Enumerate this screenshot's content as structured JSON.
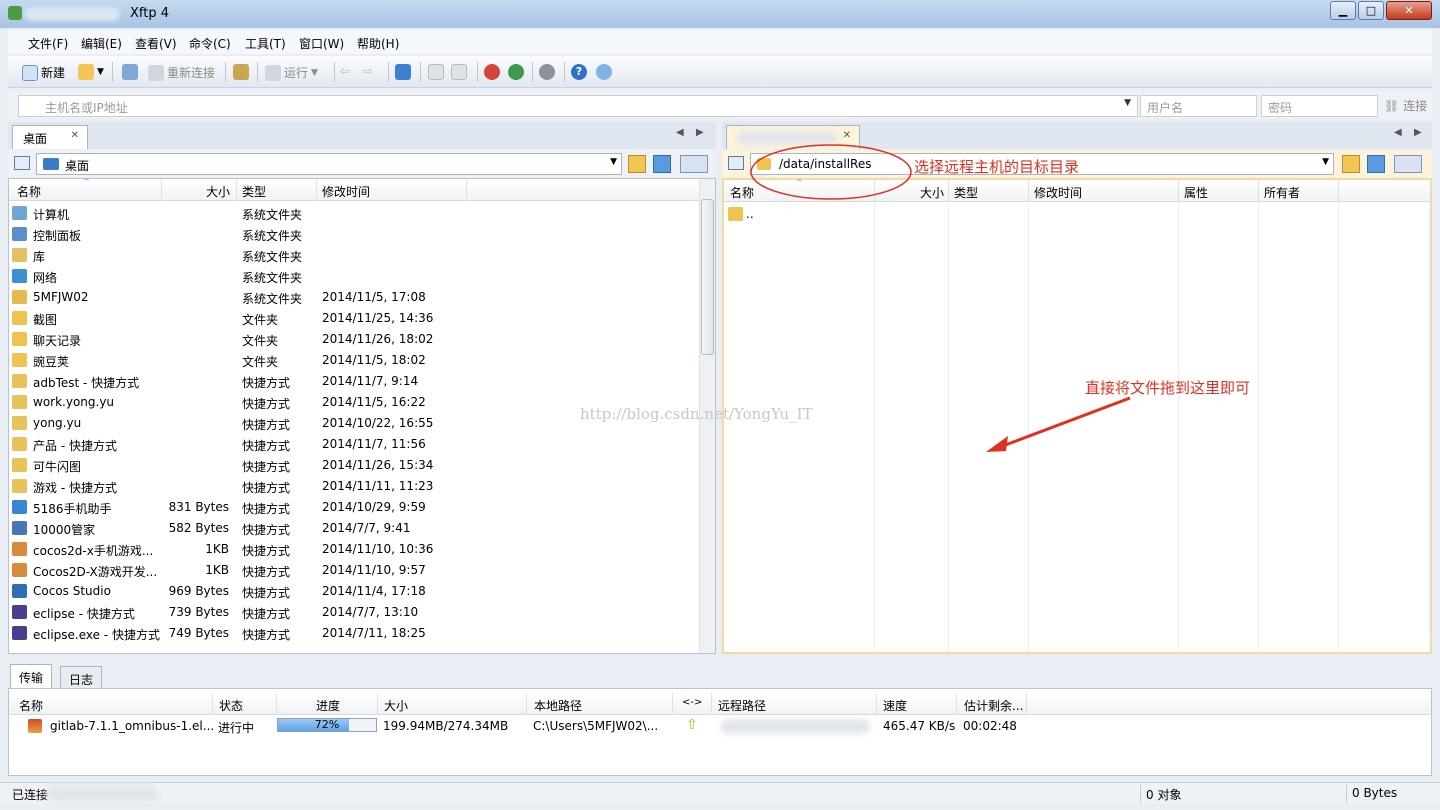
{
  "window": {
    "title": "Xftp 4"
  },
  "menu": [
    "文件(F)",
    "编辑(E)",
    "查看(V)",
    "命令(C)",
    "工具(T)",
    "窗口(W)",
    "帮助(H)"
  ],
  "toolbar": {
    "new_label": "新建",
    "reconnect_label": "重新连接",
    "run_label": "运行"
  },
  "address": {
    "host_placeholder": "主机名或IP地址",
    "user_placeholder": "用户名",
    "password_placeholder": "密码",
    "connect_label": "连接"
  },
  "left": {
    "tab_label": "桌面",
    "path": "桌面",
    "columns": [
      "名称",
      "大小",
      "类型",
      "修改时间"
    ],
    "rows": [
      {
        "name": "计算机",
        "size": "",
        "type": "系统文件夹",
        "modified": "",
        "icon": "computer-icon",
        "color": "#6fa6d6"
      },
      {
        "name": "控制面板",
        "size": "",
        "type": "系统文件夹",
        "modified": "",
        "icon": "control-panel-icon",
        "color": "#5a8fc8"
      },
      {
        "name": "库",
        "size": "",
        "type": "系统文件夹",
        "modified": "",
        "icon": "library-icon",
        "color": "#e2c162"
      },
      {
        "name": "网络",
        "size": "",
        "type": "系统文件夹",
        "modified": "",
        "icon": "network-icon",
        "color": "#3c8fd0"
      },
      {
        "name": "5MFJW02",
        "size": "",
        "type": "系统文件夹",
        "modified": "2014/11/5, 17:08",
        "icon": "user-folder-icon",
        "color": "#e6b94d"
      },
      {
        "name": "截图",
        "size": "",
        "type": "文件夹",
        "modified": "2014/11/25, 14:36",
        "icon": "folder-icon",
        "color": "#f0c24f"
      },
      {
        "name": "聊天记录",
        "size": "",
        "type": "文件夹",
        "modified": "2014/11/26, 18:02",
        "icon": "folder-icon",
        "color": "#f0c24f"
      },
      {
        "name": "豌豆荚",
        "size": "",
        "type": "文件夹",
        "modified": "2014/11/5, 18:02",
        "icon": "folder-icon",
        "color": "#f0c24f"
      },
      {
        "name": "adbTest - 快捷方式",
        "size": "",
        "type": "快捷方式",
        "modified": "2014/11/7, 9:14",
        "icon": "shortcut-icon",
        "color": "#e8c35a"
      },
      {
        "name": "work.yong.yu",
        "size": "",
        "type": "快捷方式",
        "modified": "2014/11/5, 16:22",
        "icon": "shortcut-icon",
        "color": "#e8c35a"
      },
      {
        "name": "yong.yu",
        "size": "",
        "type": "快捷方式",
        "modified": "2014/10/22, 16:55",
        "icon": "shortcut-icon",
        "color": "#e8c35a"
      },
      {
        "name": "产品 - 快捷方式",
        "size": "",
        "type": "快捷方式",
        "modified": "2014/11/7, 11:56",
        "icon": "shortcut-icon",
        "color": "#e8c35a"
      },
      {
        "name": "可牛闪图",
        "size": "",
        "type": "快捷方式",
        "modified": "2014/11/26, 15:34",
        "icon": "shortcut-icon",
        "color": "#e8c35a"
      },
      {
        "name": "游戏 - 快捷方式",
        "size": "",
        "type": "快捷方式",
        "modified": "2014/11/11, 11:23",
        "icon": "shortcut-icon",
        "color": "#e8c35a"
      },
      {
        "name": "5186手机助手",
        "size": "831 Bytes",
        "type": "快捷方式",
        "modified": "2014/10/29, 9:59",
        "icon": "app-shortcut-icon",
        "color": "#3a86d4"
      },
      {
        "name": "10000管家",
        "size": "582 Bytes",
        "type": "快捷方式",
        "modified": "2014/7/7, 9:41",
        "icon": "app-shortcut-icon",
        "color": "#4a74b8"
      },
      {
        "name": "cocos2d-x手机游戏...",
        "size": "1KB",
        "type": "快捷方式",
        "modified": "2014/11/10, 10:36",
        "icon": "doc-shortcut-icon",
        "color": "#d98a3a"
      },
      {
        "name": "Cocos2D-X游戏开发...",
        "size": "1KB",
        "type": "快捷方式",
        "modified": "2014/11/10, 9:57",
        "icon": "doc-shortcut-icon",
        "color": "#d98a3a"
      },
      {
        "name": "Cocos Studio",
        "size": "969 Bytes",
        "type": "快捷方式",
        "modified": "2014/11/4, 17:18",
        "icon": "app-shortcut-icon",
        "color": "#2d6fb0"
      },
      {
        "name": "eclipse - 快捷方式",
        "size": "739 Bytes",
        "type": "快捷方式",
        "modified": "2014/7/7, 13:10",
        "icon": "eclipse-icon",
        "color": "#4b3e8f"
      },
      {
        "name": "eclipse.exe - 快捷方式",
        "size": "749 Bytes",
        "type": "快捷方式",
        "modified": "2014/7/11, 18:25",
        "icon": "eclipse-icon",
        "color": "#4b3e8f"
      }
    ]
  },
  "right": {
    "path": "/data/installRes",
    "columns": [
      "名称",
      "大小",
      "类型",
      "修改时间",
      "属性",
      "所有者"
    ],
    "rows": [
      {
        "name": "..",
        "icon": "parent-folder-icon"
      }
    ],
    "annotation_path": "选择远程主机的目标目录",
    "annotation_drag": "直接将文件拖到这里即可"
  },
  "watermark": "http://blog.csdn.net/YongYu_IT",
  "bottom": {
    "tabs": [
      "传输",
      "日志"
    ],
    "columns": [
      "名称",
      "状态",
      "进度",
      "大小",
      "本地路径",
      "<->",
      "远程路径",
      "速度",
      "估计剩余..."
    ],
    "transfer": {
      "name": "gitlab-7.1.1_omnibus-1.el...",
      "status": "进行中",
      "progress": 0.72,
      "progress_label": "72%",
      "size": "199.94MB/274.34MB",
      "local_path": "C:\\Users\\5MFJW02\\...",
      "speed": "465.47 KB/s",
      "remaining": "00:02:48"
    }
  },
  "status": {
    "left": "已连接",
    "objects": "0 对象",
    "bytes": "0 Bytes"
  },
  "colors": {
    "annotation": "#e03020",
    "accent": "#5ea3e6"
  }
}
